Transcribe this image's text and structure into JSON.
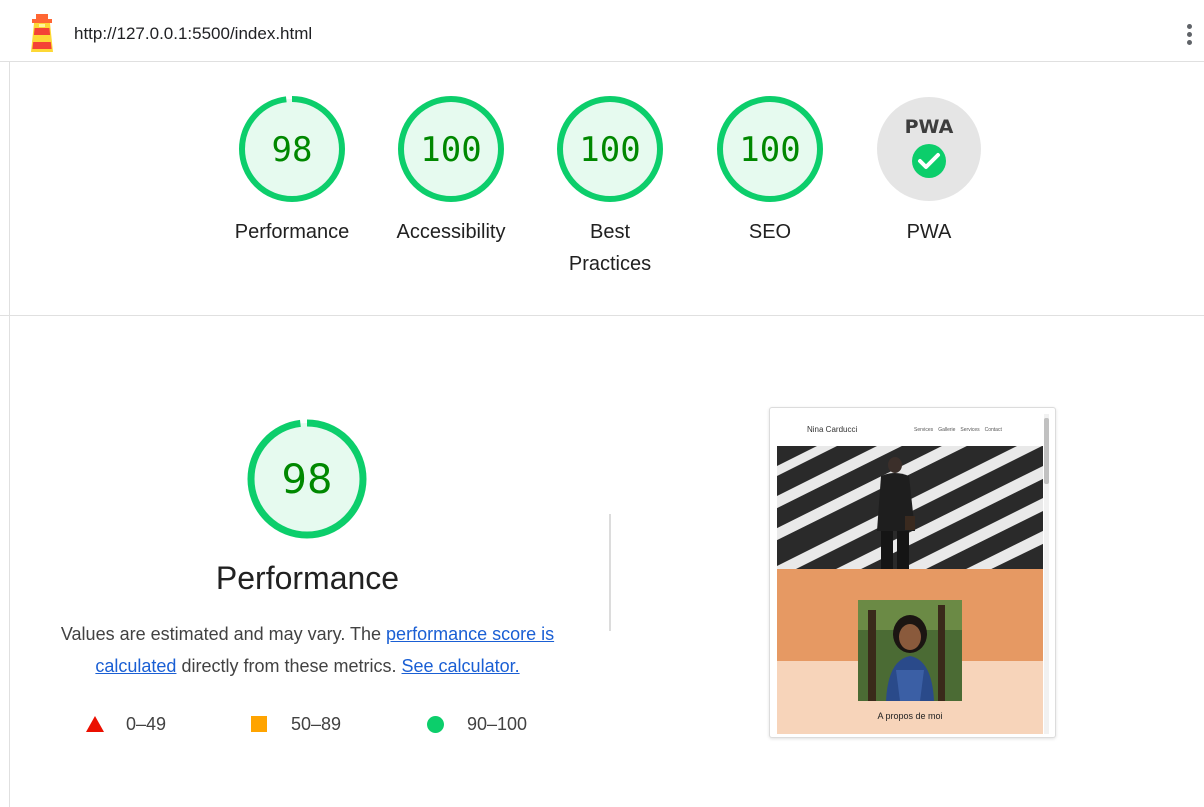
{
  "header": {
    "url": "http://127.0.0.1:5500/index.html",
    "logo_icon": "lighthouse-icon",
    "menu_icon": "kebab-menu-icon"
  },
  "scores": [
    {
      "name": "performance",
      "value": "98",
      "score": 0.98,
      "label": "Performance"
    },
    {
      "name": "accessibility",
      "value": "100",
      "score": 1.0,
      "label": "Accessibility"
    },
    {
      "name": "best-practices",
      "value": "100",
      "score": 1.0,
      "label_line1": "Best",
      "label_line2": "Practices"
    },
    {
      "name": "seo",
      "value": "100",
      "score": 1.0,
      "label": "SEO"
    }
  ],
  "pwa": {
    "badge_text": "PWA",
    "label": "PWA",
    "icon": "checkmark-icon"
  },
  "performance": {
    "score": "98",
    "score_fraction": 0.98,
    "title": "Performance",
    "desc_part1": "Values are estimated and may vary. The ",
    "link_score": "performance score is calculated",
    "desc_part2": " directly from these metrics. ",
    "link_calculator": "See calculator."
  },
  "legend": [
    {
      "range": "0–49",
      "color": "#eb0f00",
      "icon": "triangle-icon"
    },
    {
      "range": "50–89",
      "color": "#ffa400",
      "icon": "square-icon"
    },
    {
      "range": "90–100",
      "color": "#0cce6b",
      "icon": "circle-icon"
    }
  ],
  "colors": {
    "pass": "#0cce6b",
    "pass_fill": "#e6faef",
    "pass_text": "#008800",
    "link": "#1a5fd4"
  },
  "thumbnail": {
    "brand": "Nina Carducci",
    "nav_links": [
      "Services",
      "Gallerie",
      "Services",
      "Contact"
    ],
    "caption": "A propos de moi"
  }
}
